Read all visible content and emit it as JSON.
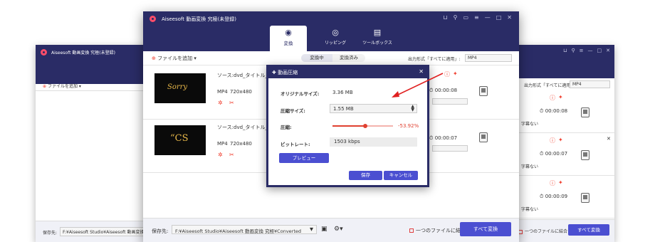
{
  "app": {
    "title": "Aiseesoft 動画変換 究極(未登録)"
  },
  "tabs": [
    {
      "label": "変換"
    },
    {
      "label": "リッピング"
    },
    {
      "label": "ツールボックス"
    }
  ],
  "toolbar": {
    "add_files": "ファイルを追加",
    "segment_converting": "変換中",
    "segment_converted": "変換済み",
    "output_format_label": "出力形式「すべてに適用」:",
    "output_format_value": "MP4"
  },
  "files": [
    {
      "source": "ソース:dvd_タイトル_1.m",
      "format": "MP4",
      "resolution": "720x480",
      "duration": "00:00:08",
      "thumb_text": "Sorry"
    },
    {
      "source": "ソース:dvd_タイトル_2.m",
      "format": "MP4",
      "resolution": "720x480",
      "duration": "00:00:07",
      "thumb_text": "“CS"
    }
  ],
  "footer": {
    "save_to_label": "保存先:",
    "save_path": "F:¥Aiseesoft Studio¥Aiseesoft 動画変換 究極¥Converted",
    "merge_label": "一つのファイルに結合",
    "convert_all": "すべて変換"
  },
  "dialog": {
    "title": "動画圧縮",
    "original_size_label": "オリジナルサイズ:",
    "original_size_value": "3.36 MB",
    "compressed_size_label": "圧縮サイズ:",
    "compressed_size_value": "1.55 MB",
    "compression_label": "圧縮:",
    "compression_percent": "-53.92%",
    "compression_level": 0.54,
    "bitrate_label": "ビットレート:",
    "bitrate_value": "1503 kbps",
    "preview_button": "プレビュー",
    "save_button": "保存",
    "cancel_button": "キャンセル"
  },
  "left_window": {
    "title": "Aiseesoft 動画変換 究極(未登録)",
    "add_files": "ファイルを追加",
    "hint_text": "ク'",
    "save_to_label": "保存先:",
    "save_path": "F:¥Aiseesoft Studio¥Aiseesoft 動画変換 究極"
  },
  "right_window": {
    "output_format_label": "出力形式「すべてに適用」:",
    "output_format_value": "MP4",
    "rows": [
      {
        "duration": "00:00:08",
        "dropdown": "字幕ない"
      },
      {
        "duration": "00:00:07",
        "dropdown": "字幕ない"
      },
      {
        "duration": "00:00:09",
        "dropdown": "字幕ない"
      }
    ],
    "merge_label": "一つのファイルに結合",
    "convert_all": "すべて変換"
  },
  "colors": {
    "titlebar": "#2a2c66",
    "accent": "#4b4fd1",
    "arrow": "#e02020"
  }
}
